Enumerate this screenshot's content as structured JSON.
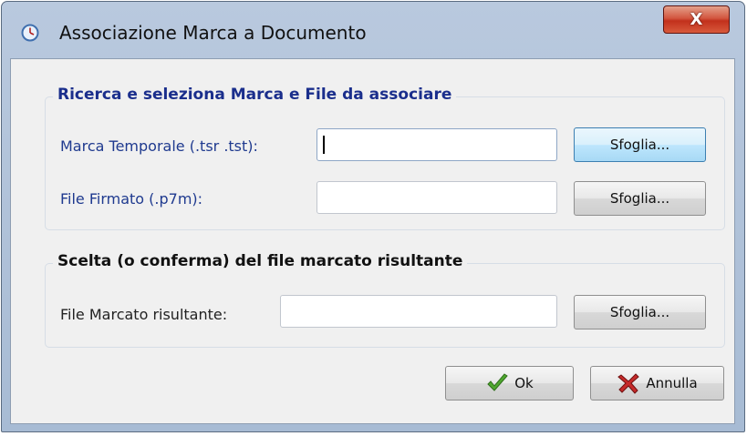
{
  "window": {
    "title": "Associazione Marca a Documento",
    "close_label": "X"
  },
  "search_group": {
    "title": "Ricerca e seleziona Marca e File da associare",
    "timestamp_label": "Marca Temporale (.tsr .tst):",
    "timestamp_value": "",
    "timestamp_browse": "Sfoglia...",
    "signed_label": "File Firmato (.p7m):",
    "signed_value": "",
    "signed_browse": "Sfoglia..."
  },
  "result_group": {
    "title": "Scelta (o conferma) del file marcato risultante",
    "result_label": "File Marcato risultante:",
    "result_value": "",
    "result_browse": "Sfoglia..."
  },
  "actions": {
    "ok_label": "Ok",
    "cancel_label": "Annulla"
  },
  "icons": {
    "app": "clock-icon",
    "ok": "checkmark-icon",
    "cancel": "cross-icon"
  },
  "colors": {
    "group_title_blue": "#1a2e8c",
    "label_blue": "#1f3a8f",
    "titlebar": "#b9c9de",
    "close_red": "#c2301c"
  }
}
